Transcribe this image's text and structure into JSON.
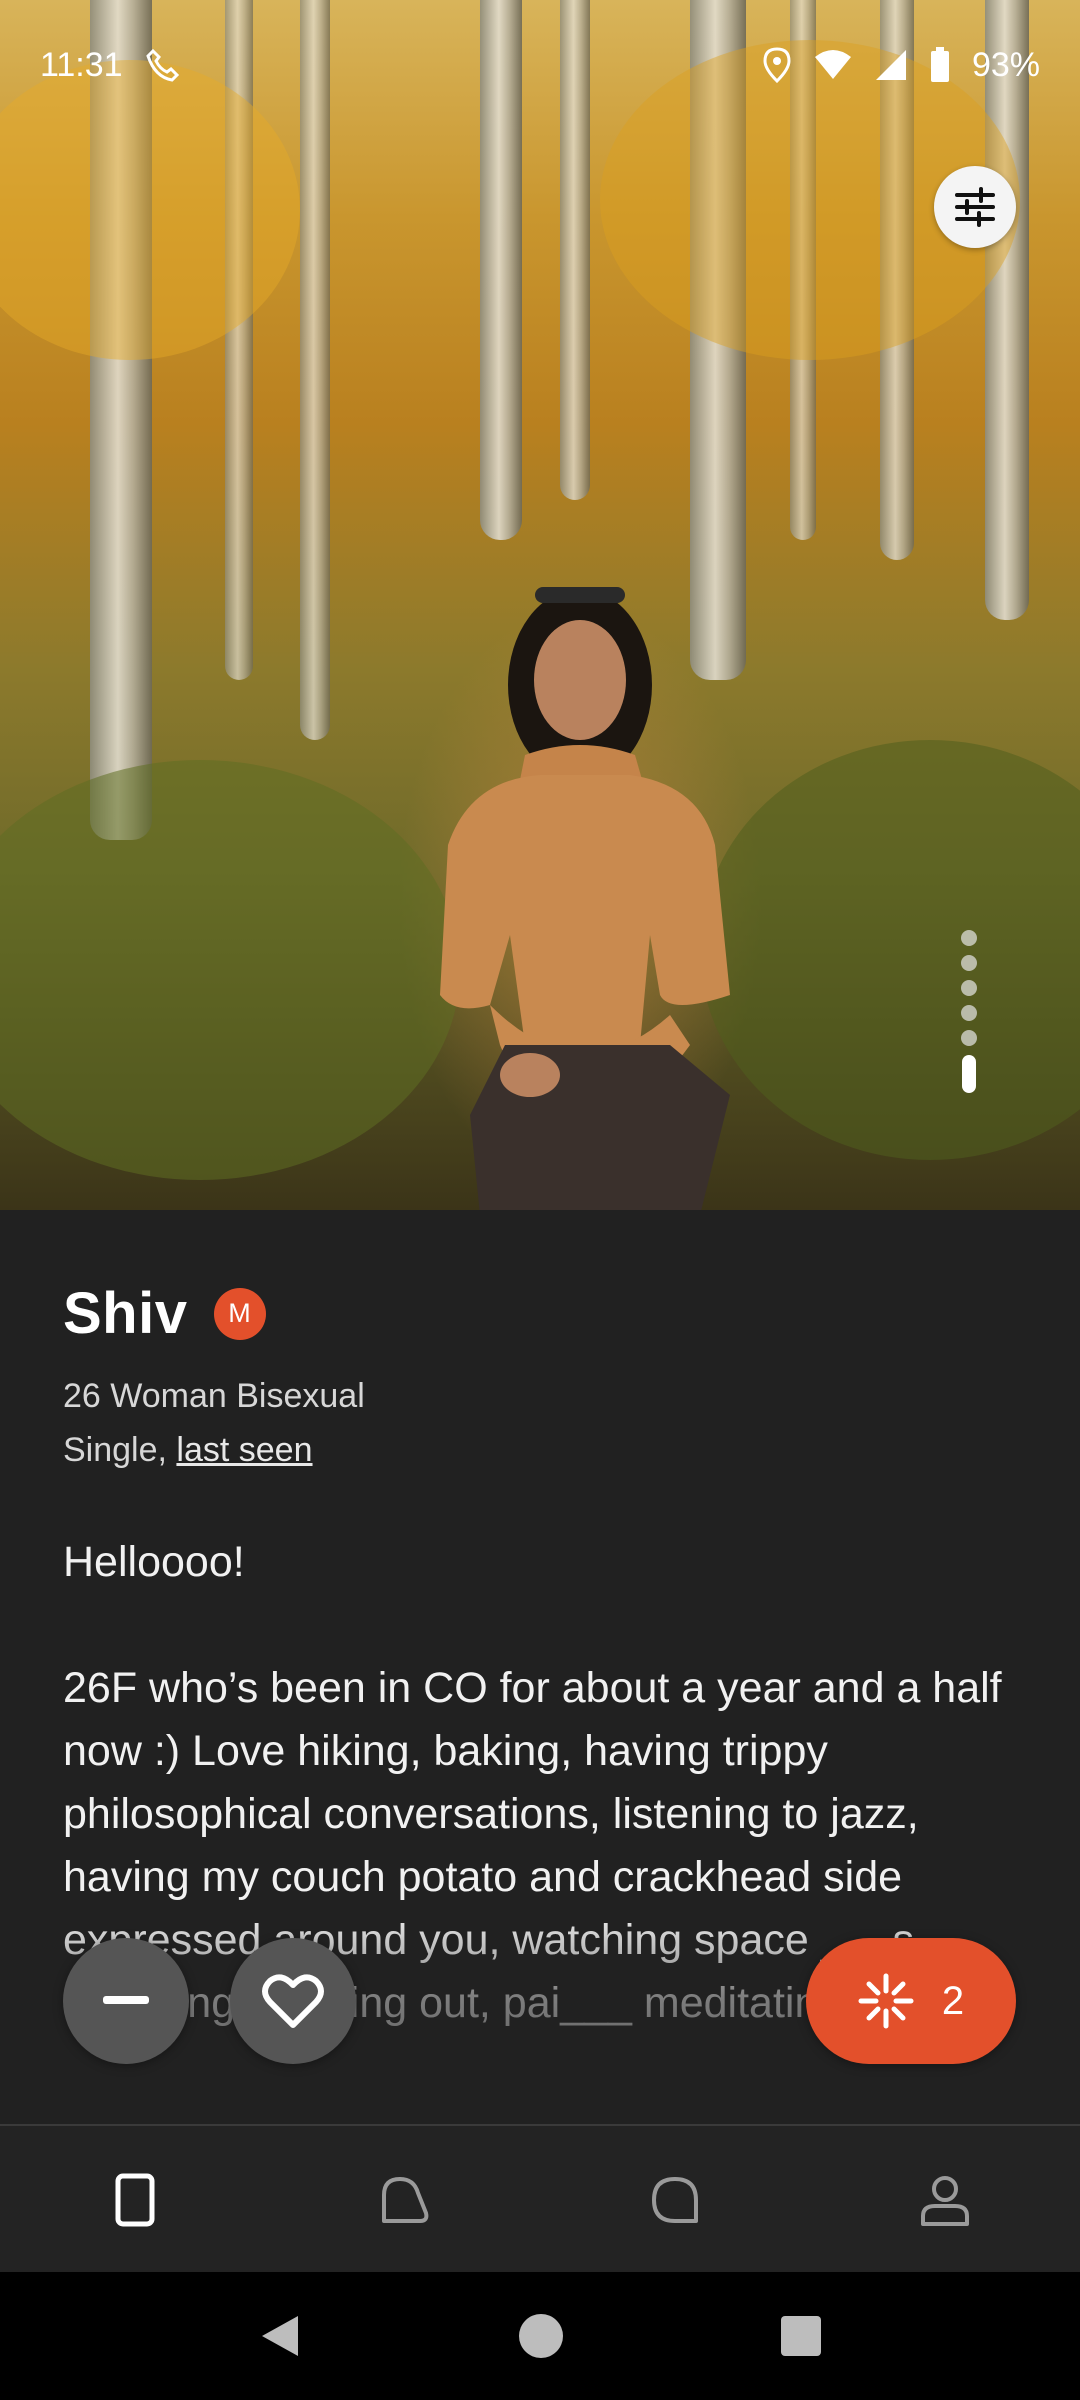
{
  "status_bar": {
    "time": "11:31",
    "battery": "93%"
  },
  "profile": {
    "name": "Shiv",
    "badge_letter": "M",
    "details": "26 Woman Bisexual",
    "relationship": "Single,",
    "last_seen_link": "last seen",
    "bio_greeting": "Helloooo!",
    "bio_text": "26F who’s been in CO for about a year and a half now :) Love hiking, baking, having trippy philosophical conversations, listening to jazz, having my couch potato and crackhead side expressed around you, watching space ___s, s___zing, working out, pai___ meditating."
  },
  "photo": {
    "count": 6,
    "current_index": 6
  },
  "actions": {
    "boost_count": "2"
  },
  "nav": {
    "items": [
      "discover-tab",
      "likes-tab",
      "chats-tab",
      "profile-tab"
    ]
  },
  "colors": {
    "accent": "#e3502b",
    "background": "#212121"
  }
}
